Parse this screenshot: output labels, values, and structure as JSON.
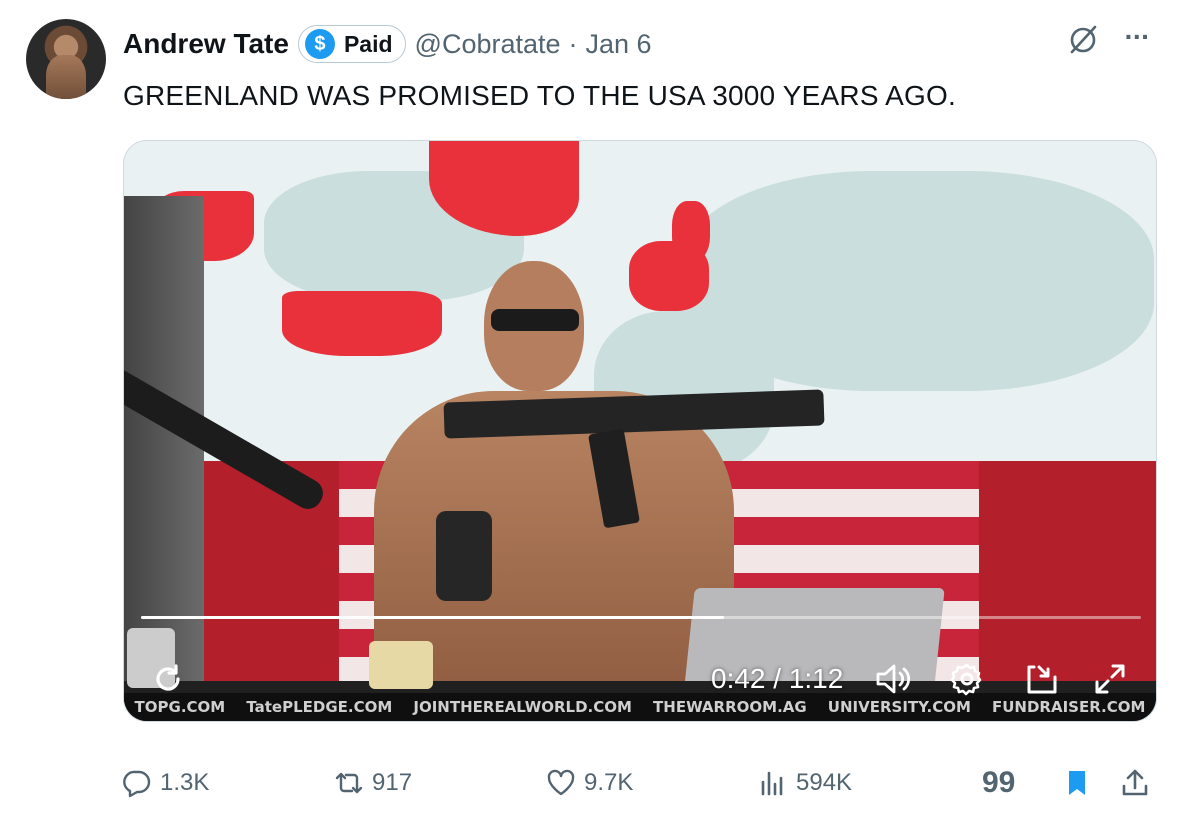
{
  "author": {
    "name": "Andrew Tate",
    "badge_label": "Paid",
    "badge_icon": "$",
    "handle": "@Cobratate",
    "separator": "·",
    "date": "Jan 6"
  },
  "tweet": {
    "text": "GREENLAND WAS PROMISED TO THE USA 3000 YEARS AGO."
  },
  "video": {
    "time": "0:42 / 1:12",
    "progress_fraction": 0.583,
    "banner": [
      "TOPG.COM",
      "TatePLEDGE.COM",
      "JOINTHEREALWORLD.COM",
      "THEWARROOM.AG",
      "UNIVERSITY.COM",
      "FUNDRAISER.COM"
    ]
  },
  "actions": {
    "replies": "1.3K",
    "reposts": "917",
    "likes": "9.7K",
    "views": "594K",
    "grok_label": "99"
  },
  "colors": {
    "accent": "#1d9bf0",
    "muted": "#536471",
    "text": "#0f1419"
  }
}
